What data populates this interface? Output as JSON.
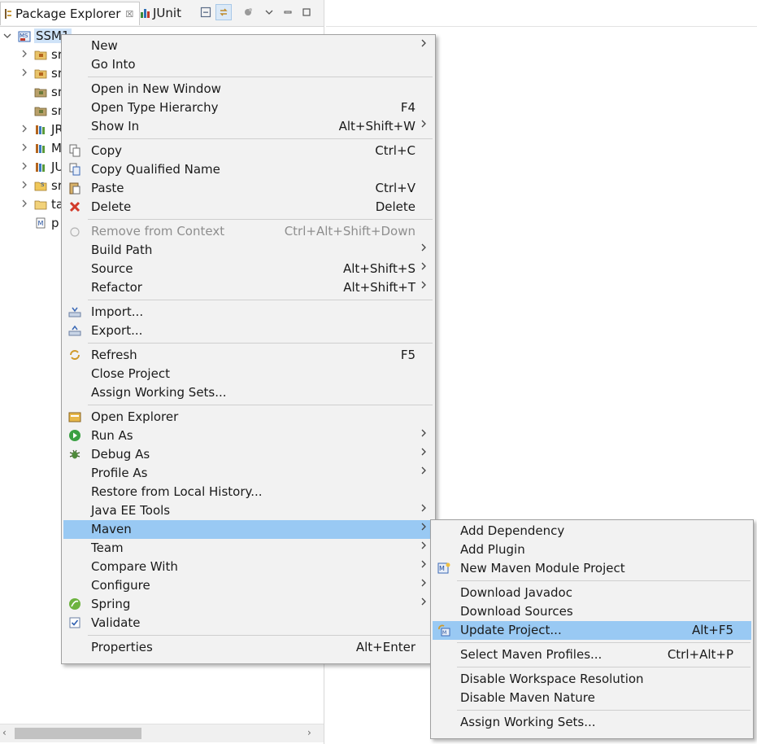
{
  "view": {
    "tabs": [
      {
        "label": "Package Explorer",
        "close": "☒"
      },
      {
        "label": "JUnit"
      }
    ]
  },
  "tree": {
    "project": "SSM1",
    "children": [
      {
        "label": "sr",
        "arrow": "›",
        "icon": "package-folder"
      },
      {
        "label": "sr",
        "arrow": "›",
        "icon": "package-folder"
      },
      {
        "label": "sr",
        "arrow": "",
        "icon": "package-folder-gray"
      },
      {
        "label": "sr",
        "arrow": "",
        "icon": "package-folder-gray"
      },
      {
        "label": "JR",
        "arrow": "›",
        "icon": "library"
      },
      {
        "label": "M",
        "arrow": "›",
        "icon": "library"
      },
      {
        "label": "JU",
        "arrow": "›",
        "icon": "library"
      },
      {
        "label": "sr",
        "arrow": "›",
        "icon": "folder-source"
      },
      {
        "label": "ta",
        "arrow": "›",
        "icon": "folder"
      },
      {
        "label": "p",
        "arrow": "",
        "icon": "maven-pom"
      }
    ]
  },
  "context_menu": {
    "items": [
      {
        "label": "New",
        "submenu": true
      },
      {
        "label": "Go Into"
      },
      {
        "sep": true
      },
      {
        "label": "Open in New Window"
      },
      {
        "label": "Open Type Hierarchy",
        "shortcut": "F4"
      },
      {
        "label": "Show In",
        "shortcut": "Alt+Shift+W",
        "submenu": true
      },
      {
        "sep": true
      },
      {
        "label": "Copy",
        "shortcut": "Ctrl+C",
        "icon": "copy-icon"
      },
      {
        "label": "Copy Qualified Name",
        "icon": "copy-qualified-icon"
      },
      {
        "label": "Paste",
        "shortcut": "Ctrl+V",
        "icon": "paste-icon"
      },
      {
        "label": "Delete",
        "shortcut": "Delete",
        "icon": "delete-icon"
      },
      {
        "sep": true
      },
      {
        "label": "Remove from Context",
        "shortcut": "Ctrl+Alt+Shift+Down",
        "icon": "remove-context-icon",
        "disabled": true
      },
      {
        "label": "Build Path",
        "submenu": true
      },
      {
        "label": "Source",
        "shortcut": "Alt+Shift+S",
        "submenu": true
      },
      {
        "label": "Refactor",
        "shortcut": "Alt+Shift+T",
        "submenu": true
      },
      {
        "sep": true
      },
      {
        "label": "Import...",
        "icon": "import-icon"
      },
      {
        "label": "Export...",
        "icon": "export-icon"
      },
      {
        "sep": true
      },
      {
        "label": "Refresh",
        "shortcut": "F5",
        "icon": "refresh-icon"
      },
      {
        "label": "Close Project"
      },
      {
        "label": "Assign Working Sets..."
      },
      {
        "sep": true
      },
      {
        "label": "Open Explorer",
        "icon": "open-explorer-icon"
      },
      {
        "label": "Run As",
        "submenu": true,
        "icon": "run-icon"
      },
      {
        "label": "Debug As",
        "submenu": true,
        "icon": "debug-icon"
      },
      {
        "label": "Profile As",
        "submenu": true
      },
      {
        "label": "Restore from Local History..."
      },
      {
        "label": "Java EE Tools",
        "submenu": true
      },
      {
        "label": "Maven",
        "submenu": true,
        "highlighted": true
      },
      {
        "label": "Team",
        "submenu": true
      },
      {
        "label": "Compare With",
        "submenu": true
      },
      {
        "label": "Configure",
        "submenu": true
      },
      {
        "label": "Spring",
        "submenu": true,
        "icon": "spring-icon"
      },
      {
        "label": "Validate",
        "icon": "validate-icon"
      },
      {
        "sep": true
      },
      {
        "label": "Properties",
        "shortcut": "Alt+Enter"
      }
    ]
  },
  "maven_submenu": {
    "items": [
      {
        "label": "Add Dependency"
      },
      {
        "label": "Add Plugin"
      },
      {
        "label": "New Maven Module Project",
        "icon": "maven-module-icon"
      },
      {
        "sep": true
      },
      {
        "label": "Download Javadoc"
      },
      {
        "label": "Download Sources"
      },
      {
        "label": "Update Project...",
        "shortcut": "Alt+F5",
        "icon": "update-project-icon",
        "highlighted": true
      },
      {
        "sep": true
      },
      {
        "label": "Select Maven Profiles...",
        "shortcut": "Ctrl+Alt+P"
      },
      {
        "sep": true
      },
      {
        "label": "Disable Workspace Resolution"
      },
      {
        "label": "Disable Maven Nature"
      },
      {
        "sep": true
      },
      {
        "label": "Assign Working Sets..."
      }
    ]
  },
  "colors": {
    "menu_bg": "#f2f2f2",
    "highlight": "#99c9f3",
    "disabled_text": "#8e8e8e"
  }
}
